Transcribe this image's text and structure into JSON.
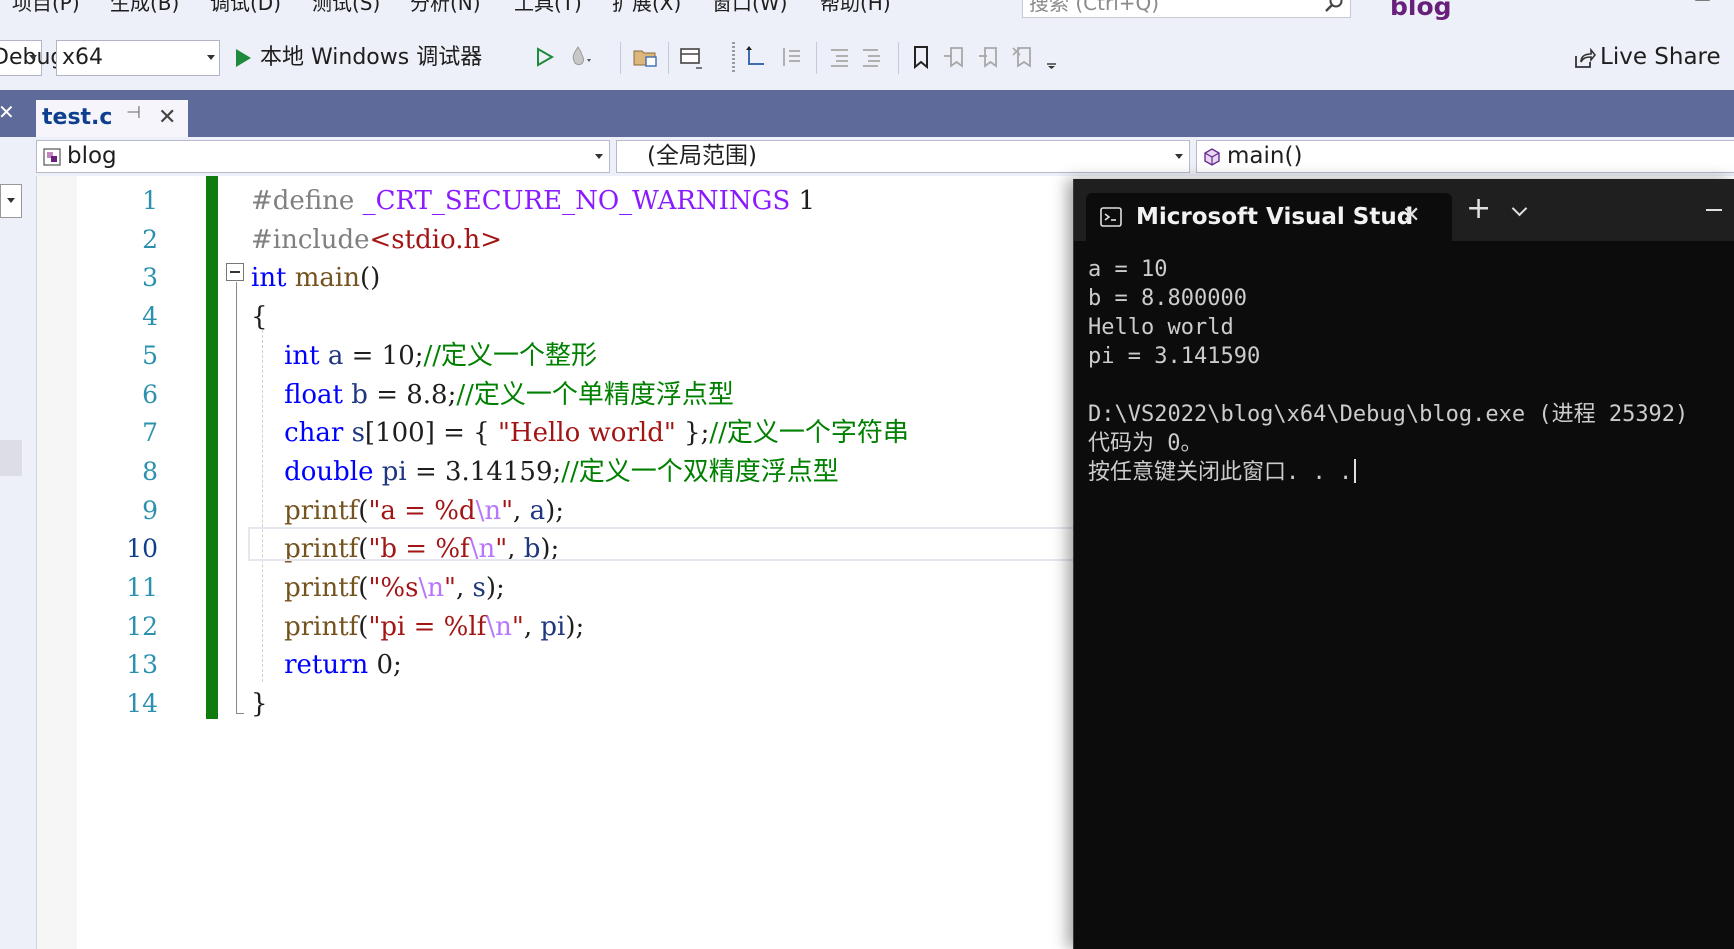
{
  "menu": {
    "items": [
      "项目(P)",
      "生成(B)",
      "调试(D)",
      "测试(S)",
      "分析(N)",
      "工具(T)",
      "扩展(X)",
      "窗口(W)",
      "帮助(H)"
    ],
    "search_placeholder": "搜索 (Ctrl+Q)",
    "app_title": "blog"
  },
  "toolbar": {
    "config_value": "Debug",
    "platform_value": "x64",
    "debugger_label": "本地 Windows 调试器",
    "live_share_label": "Live Share"
  },
  "tabs": {
    "active_tab": "test.c"
  },
  "navbar": {
    "project": "blog",
    "scope": "(全局范围)",
    "member": "main()"
  },
  "editor": {
    "current_line": 10,
    "line_numbers": [
      "1",
      "2",
      "3",
      "4",
      "5",
      "6",
      "7",
      "8",
      "9",
      "10",
      "11",
      "12",
      "13",
      "14"
    ],
    "lines": [
      [
        [
          "pp",
          "#define "
        ],
        [
          "macro",
          "_CRT_SECURE_NO_WARNINGS"
        ],
        [
          "num",
          " 1"
        ]
      ],
      [
        [
          "pp",
          "#include"
        ],
        [
          "str",
          "<stdio.h>"
        ]
      ],
      [
        [
          "kw",
          "int"
        ],
        [
          "txt",
          " "
        ],
        [
          "fn",
          "main"
        ],
        [
          "txt",
          "()"
        ]
      ],
      [
        [
          "txt",
          "{"
        ]
      ],
      [
        [
          "txt",
          "    "
        ],
        [
          "kw",
          "int"
        ],
        [
          "txt",
          " "
        ],
        [
          "var",
          "a"
        ],
        [
          "txt",
          " = 10;"
        ],
        [
          "cm",
          "//定义一个整形"
        ]
      ],
      [
        [
          "txt",
          "    "
        ],
        [
          "kw",
          "float"
        ],
        [
          "txt",
          " "
        ],
        [
          "var",
          "b"
        ],
        [
          "txt",
          " = 8.8;"
        ],
        [
          "cm",
          "//定义一个单精度浮点型"
        ]
      ],
      [
        [
          "txt",
          "    "
        ],
        [
          "kw",
          "char"
        ],
        [
          "txt",
          " "
        ],
        [
          "var",
          "s"
        ],
        [
          "txt",
          "[100] = { "
        ],
        [
          "str",
          "\"Hello world\""
        ],
        [
          "txt",
          " };"
        ],
        [
          "cm",
          "//定义一个字符串"
        ]
      ],
      [
        [
          "txt",
          "    "
        ],
        [
          "kw",
          "double"
        ],
        [
          "txt",
          " "
        ],
        [
          "var",
          "pi"
        ],
        [
          "txt",
          " = 3.14159;"
        ],
        [
          "cm",
          "//定义一个双精度浮点型"
        ]
      ],
      [
        [
          "txt",
          "    "
        ],
        [
          "fn",
          "printf"
        ],
        [
          "txt",
          "("
        ],
        [
          "str",
          "\"a = %d"
        ],
        [
          "esc",
          "\\n"
        ],
        [
          "str",
          "\""
        ],
        [
          "txt",
          ", "
        ],
        [
          "var",
          "a"
        ],
        [
          "txt",
          ");"
        ]
      ],
      [
        [
          "txt",
          "    "
        ],
        [
          "fn",
          "printf"
        ],
        [
          "txt",
          "("
        ],
        [
          "str",
          "\"b = %f"
        ],
        [
          "esc",
          "\\n"
        ],
        [
          "str",
          "\""
        ],
        [
          "txt",
          ", "
        ],
        [
          "var",
          "b"
        ],
        [
          "txt",
          ");"
        ]
      ],
      [
        [
          "txt",
          "    "
        ],
        [
          "fn",
          "printf"
        ],
        [
          "txt",
          "("
        ],
        [
          "str",
          "\"%s"
        ],
        [
          "esc",
          "\\n"
        ],
        [
          "str",
          "\""
        ],
        [
          "txt",
          ", "
        ],
        [
          "var",
          "s"
        ],
        [
          "txt",
          ");"
        ]
      ],
      [
        [
          "txt",
          "    "
        ],
        [
          "fn",
          "printf"
        ],
        [
          "txt",
          "("
        ],
        [
          "str",
          "\"pi = %lf"
        ],
        [
          "esc",
          "\\n"
        ],
        [
          "str",
          "\""
        ],
        [
          "txt",
          ", "
        ],
        [
          "var",
          "pi"
        ],
        [
          "txt",
          ");"
        ]
      ],
      [
        [
          "txt",
          "    "
        ],
        [
          "kw",
          "return"
        ],
        [
          "txt",
          " 0;"
        ]
      ],
      [
        [
          "txt",
          "}"
        ]
      ]
    ]
  },
  "console": {
    "tab_title": "Microsoft Visual Stud",
    "lines": [
      "a = 10",
      "b = 8.800000",
      "Hello world",
      "pi = 3.141590",
      "",
      "D:\\VS2022\\blog\\x64\\Debug\\blog.exe (进程 25392)",
      "代码为 0。",
      "按任意键关闭此窗口. . ."
    ]
  },
  "colors": {
    "accent": "#68217a",
    "tabstrip": "#5e6a99",
    "change_bar": "#107c10",
    "keyword": "#0000ff",
    "comment": "#008000",
    "string": "#a31515",
    "console_bg": "#0c0c0c"
  },
  "icons": [
    "search-icon",
    "play-icon",
    "play-outline-icon",
    "hot-reload-icon",
    "folder-icon",
    "layout-icon",
    "step-icon",
    "bookmark-icon",
    "live-share-icon",
    "terminal-icon",
    "close-icon",
    "plus-icon",
    "chevron-down-icon",
    "minimize-icon",
    "maximize-icon",
    "pin-icon",
    "class-icon",
    "method-icon"
  ]
}
